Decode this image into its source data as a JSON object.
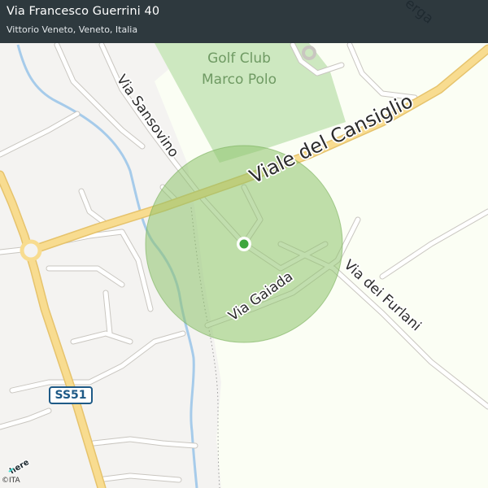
{
  "header": {
    "title": "Via Francesco Guerrini 40",
    "subtitle": "Vittorio Veneto, Veneto, Italia"
  },
  "map": {
    "partial_street_top_right": "erga",
    "park_label_line1": "Golf Club",
    "park_label_line2": "Marco Polo",
    "streets": {
      "cansiglio": "Viale del Cansiglio",
      "sansovino": "Via Sansovino",
      "gaiada": "Via Gaiada",
      "furlani": "Via dei Furlani"
    },
    "route_shield": "SS51",
    "attribution": "©ITA",
    "logo_text": "here"
  },
  "colors": {
    "header_bg": "#1e2a30",
    "land": "#f4f3f1",
    "green_area": "#fbfef4",
    "golf": "#cde8c0",
    "major_road": "#f8dc90",
    "minor_road": "#ffffff",
    "river": "#a6cbea",
    "accuracy_circle": "#8ec36b",
    "location_dot": "#3ea63e",
    "shield_blue": "#1e5a87"
  }
}
